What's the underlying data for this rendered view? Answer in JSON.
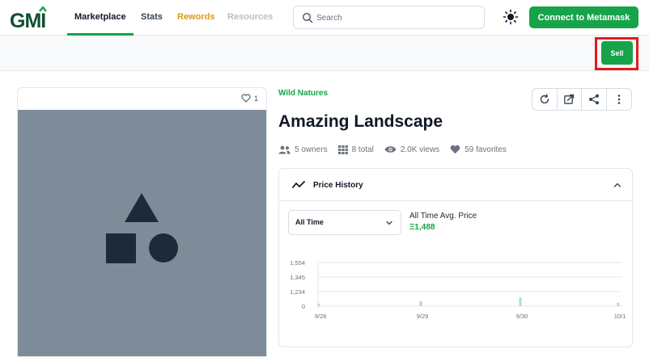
{
  "brand": {
    "logo_text": "GMI",
    "accent": "#16a34a"
  },
  "nav": {
    "items": [
      {
        "label": "Marketplace",
        "active": true
      },
      {
        "label": "Stats"
      },
      {
        "label": "Rewords",
        "color": "#d99a1c"
      },
      {
        "label": "Resources",
        "disabled": true
      }
    ]
  },
  "search": {
    "placeholder": "Search",
    "value": ""
  },
  "header": {
    "theme_icon": "sun-icon",
    "connect_label": "Connect to Metamask"
  },
  "actionbar": {
    "sell_label": "Sell",
    "highlight_color": "#e31b1b"
  },
  "item": {
    "favorites_count": "1",
    "collection": "Wild Natures",
    "title": "Amazing Landscape",
    "stats": {
      "owners": "5 owners",
      "total": "8 total",
      "views": "2.0K views",
      "favorites": "59 favorites"
    },
    "tools": [
      "refresh-icon",
      "external-link-icon",
      "share-icon",
      "more-icon"
    ]
  },
  "price_history": {
    "title": "Price History",
    "period": "All Time",
    "avg_label": "All Time Avg. Price",
    "avg_value": "Ξ1,488"
  },
  "chart_data": {
    "type": "bar",
    "categories": [
      "9/28",
      "9/29",
      "9/30",
      "10/1"
    ],
    "y_ticks": [
      "1,554",
      "1,345",
      "1,234",
      "0"
    ],
    "ylim": [
      0,
      1554
    ],
    "series": [
      {
        "x": 0.0,
        "value": 90
      },
      {
        "x": 1.0,
        "value": 180
      },
      {
        "x": 2.0,
        "value": 310
      },
      {
        "x": 3.0,
        "value": 120
      }
    ],
    "bar_color": "#a7e3c6",
    "grid": true
  }
}
